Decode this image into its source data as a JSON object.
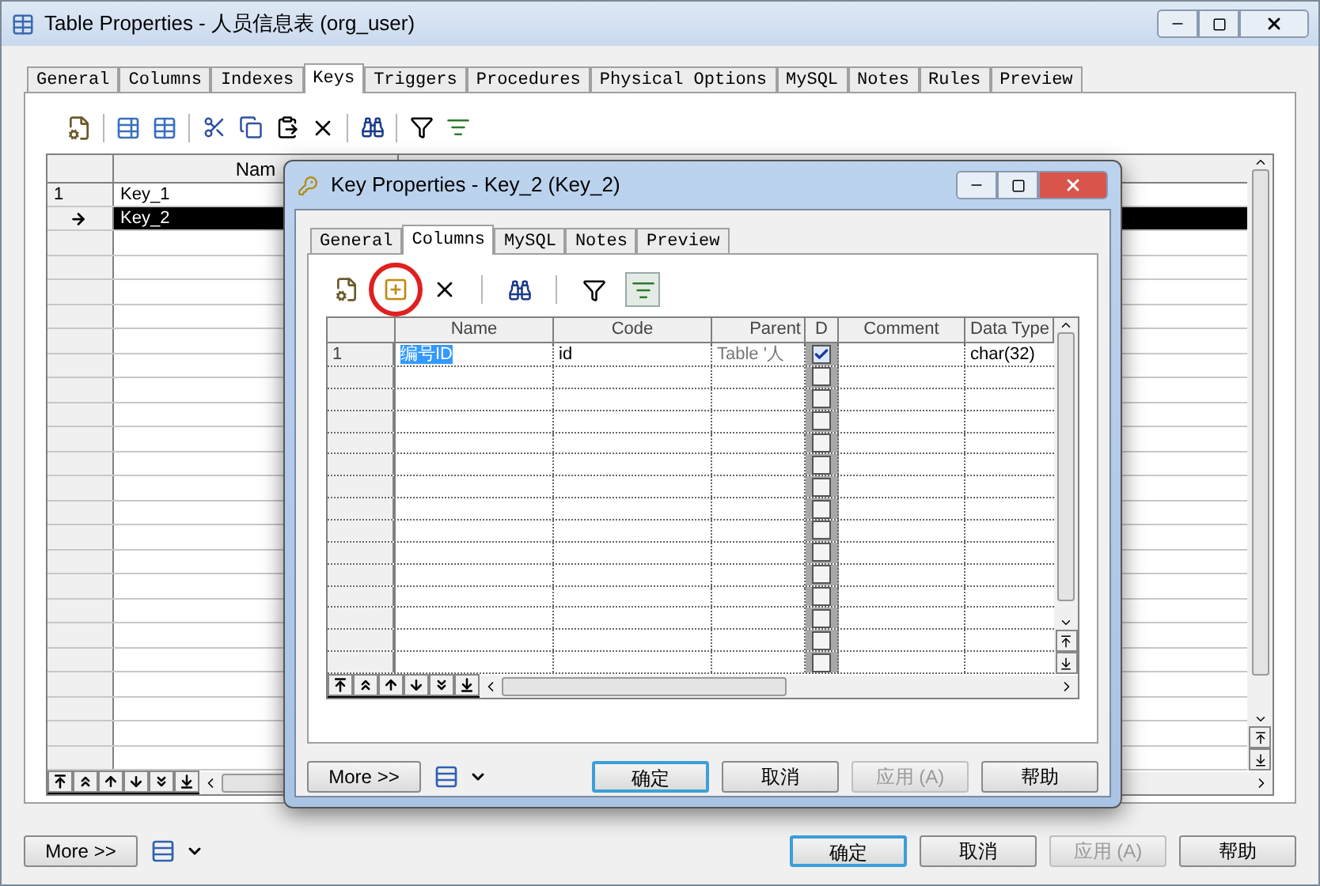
{
  "window": {
    "title": "Table Properties - 人员信息表 (org_user)"
  },
  "tabs": [
    {
      "label": "General",
      "selected": false
    },
    {
      "label": "Columns",
      "selected": false
    },
    {
      "label": "Indexes",
      "selected": false
    },
    {
      "label": "Keys",
      "selected": true
    },
    {
      "label": "Triggers",
      "selected": false
    },
    {
      "label": "Procedures",
      "selected": false
    },
    {
      "label": "Physical Options",
      "selected": false
    },
    {
      "label": "MySQL",
      "selected": false
    },
    {
      "label": "Notes",
      "selected": false
    },
    {
      "label": "Rules",
      "selected": false
    },
    {
      "label": "Preview",
      "selected": false
    }
  ],
  "grid": {
    "name_column": "Nam",
    "rows": [
      {
        "number": "1",
        "name": "Key_1",
        "selected": false
      },
      {
        "number": "",
        "name": "Key_2",
        "selected": true
      }
    ]
  },
  "more_button": "More >>",
  "buttons": [
    {
      "label": "确定",
      "kind": "default"
    },
    {
      "label": "取消",
      "kind": "normal"
    },
    {
      "label": "应用 (A)",
      "kind": "disabled"
    },
    {
      "label": "帮助",
      "kind": "normal"
    }
  ],
  "dialog": {
    "title": "Key Properties - Key_2 (Key_2)",
    "tabs": [
      {
        "label": "General",
        "selected": false
      },
      {
        "label": "Columns",
        "selected": true
      },
      {
        "label": "MySQL",
        "selected": false
      },
      {
        "label": "Notes",
        "selected": false
      },
      {
        "label": "Preview",
        "selected": false
      }
    ],
    "columns": [
      "Name",
      "Code",
      "Parent",
      "D",
      "Comment",
      "Data Type"
    ],
    "rows": [
      {
        "number": "1",
        "name": "编号ID",
        "code": "id",
        "parent": "Table '人",
        "checked": true,
        "comment": "",
        "data_type": "char(32)"
      },
      {
        "checked": false
      },
      {
        "checked": false
      },
      {
        "checked": false
      },
      {
        "checked": false
      },
      {
        "checked": false
      },
      {
        "checked": false
      },
      {
        "checked": false
      },
      {
        "checked": false
      },
      {
        "checked": false
      },
      {
        "checked": false
      },
      {
        "checked": false
      },
      {
        "checked": false
      },
      {
        "checked": false
      },
      {
        "checked": false
      }
    ],
    "more_button": "More >>",
    "buttons": [
      {
        "label": "确定",
        "kind": "default"
      },
      {
        "label": "取消",
        "kind": "normal"
      },
      {
        "label": "应用 (A)",
        "kind": "disabled"
      },
      {
        "label": "帮助",
        "kind": "normal"
      }
    ]
  }
}
